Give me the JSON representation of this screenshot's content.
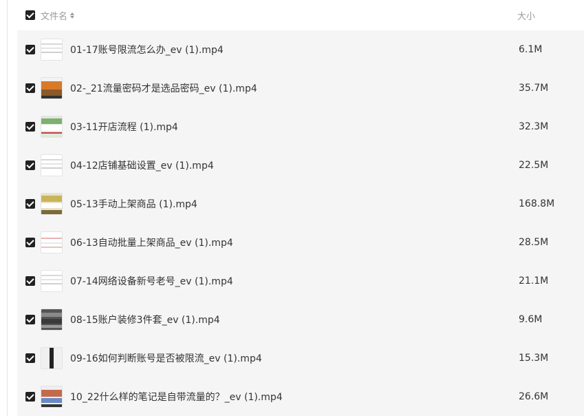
{
  "header": {
    "name_label": "文件名",
    "size_label": "大小",
    "sort_icon": "sort-icon"
  },
  "files": [
    {
      "name": "01-17账号限流怎么办_ev (1).mp4",
      "size": "6.1M",
      "thumb": "white-doc"
    },
    {
      "name": "02-_21流量密码才是选品密码_ev (1).mp4",
      "size": "35.7M",
      "thumb": "orange-photo"
    },
    {
      "name": "03-11开店流程 (1).mp4",
      "size": "32.3M",
      "thumb": "green-screen"
    },
    {
      "name": "04-12店铺基础设置_ev (1).mp4",
      "size": "22.5M",
      "thumb": "white-doc"
    },
    {
      "name": "05-13手动上架商品 (1).mp4",
      "size": "168.8M",
      "thumb": "yellow-screen"
    },
    {
      "name": "06-13自动批量上架商品_ev (1).mp4",
      "size": "28.5M",
      "thumb": "white-doc-red"
    },
    {
      "name": "07-14网络设备新号老号_ev (1).mp4",
      "size": "21.1M",
      "thumb": "white-doc"
    },
    {
      "name": "08-15账户装修3件套_ev (1).mp4",
      "size": "9.6M",
      "thumb": "dark-grid"
    },
    {
      "name": "09-16如何判断账号是否被限流_ev (1).mp4",
      "size": "15.3M",
      "thumb": "dark-split"
    },
    {
      "name": "10_22什么样的笔记是自带流量的？_ev (1).mp4",
      "size": "26.6M",
      "thumb": "photo-grid"
    }
  ]
}
